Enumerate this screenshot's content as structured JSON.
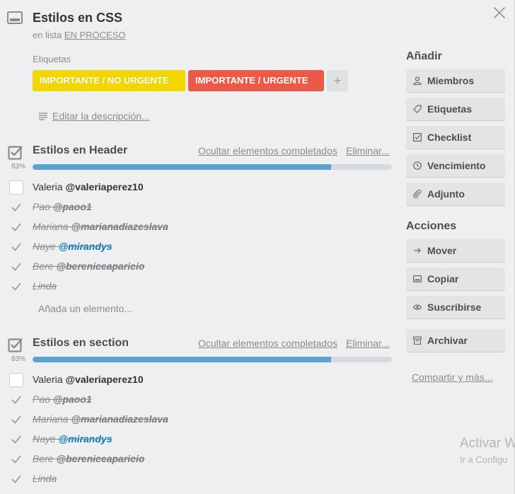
{
  "card": {
    "title": "Estilos en CSS",
    "in_list_prefix": "en lista",
    "list_name": "EN PROCESO"
  },
  "labels": {
    "heading": "Etiquetas",
    "items": [
      {
        "text": "IMPORTANTE / NO URGENTE",
        "color": "#f2d600"
      },
      {
        "text": "IMPORTANTE / URGENTE",
        "color": "#eb5a46"
      }
    ],
    "add": "+"
  },
  "description": {
    "edit_link": "Editar la descripción..."
  },
  "checklists": [
    {
      "title": "Estilos en Header",
      "hide_completed": "Ocultar elementos completados",
      "delete": "Eliminar...",
      "percent_label": "83%",
      "progress": 0.83,
      "items": [
        {
          "name": "Valeria",
          "mention": "@valeriaperez10",
          "done": false
        },
        {
          "name": "Pao",
          "mention": "@paoo1",
          "done": true
        },
        {
          "name": "Mariana",
          "mention": "@marianadiazeslava",
          "done": true
        },
        {
          "name": "Naye",
          "mention": "@mirandys",
          "done": true,
          "link": true
        },
        {
          "name": "Bere",
          "mention": "@bereniceaparicio",
          "done": true
        },
        {
          "name": "Linda",
          "mention": "",
          "done": true
        }
      ],
      "add_item": "Añada un elemento..."
    },
    {
      "title": "Estilos en section",
      "hide_completed": "Ocultar elementos completados",
      "delete": "Eliminar...",
      "percent_label": "83%",
      "progress": 0.83,
      "items": [
        {
          "name": "Valeria",
          "mention": "@valeriaperez10",
          "done": false
        },
        {
          "name": "Pao",
          "mention": "@paoo1",
          "done": true
        },
        {
          "name": "Mariana",
          "mention": "@marianadiazeslava",
          "done": true
        },
        {
          "name": "Naye",
          "mention": "@mirandys",
          "done": true,
          "link": true
        },
        {
          "name": "Bere",
          "mention": "@bereniceaparicio",
          "done": true
        },
        {
          "name": "Linda",
          "mention": "",
          "done": true
        }
      ]
    }
  ],
  "sidebar": {
    "add_heading": "Añadir",
    "add_buttons": [
      {
        "label": "Miembros",
        "icon": "person-icon"
      },
      {
        "label": "Etiquetas",
        "icon": "tag-icon"
      },
      {
        "label": "Checklist",
        "icon": "checkbox-icon"
      },
      {
        "label": "Vencimiento",
        "icon": "clock-icon"
      },
      {
        "label": "Adjunto",
        "icon": "paperclip-icon"
      }
    ],
    "actions_heading": "Acciones",
    "action_buttons": [
      {
        "label": "Mover",
        "icon": "arrow-right-icon"
      },
      {
        "label": "Copiar",
        "icon": "card-icon"
      },
      {
        "label": "Suscribirse",
        "icon": "eye-icon"
      }
    ],
    "archive_label": "Archivar",
    "share_link": "Compartir y más..."
  },
  "watermark": {
    "line1": "Activar W",
    "line2": "Ir a Configu"
  }
}
